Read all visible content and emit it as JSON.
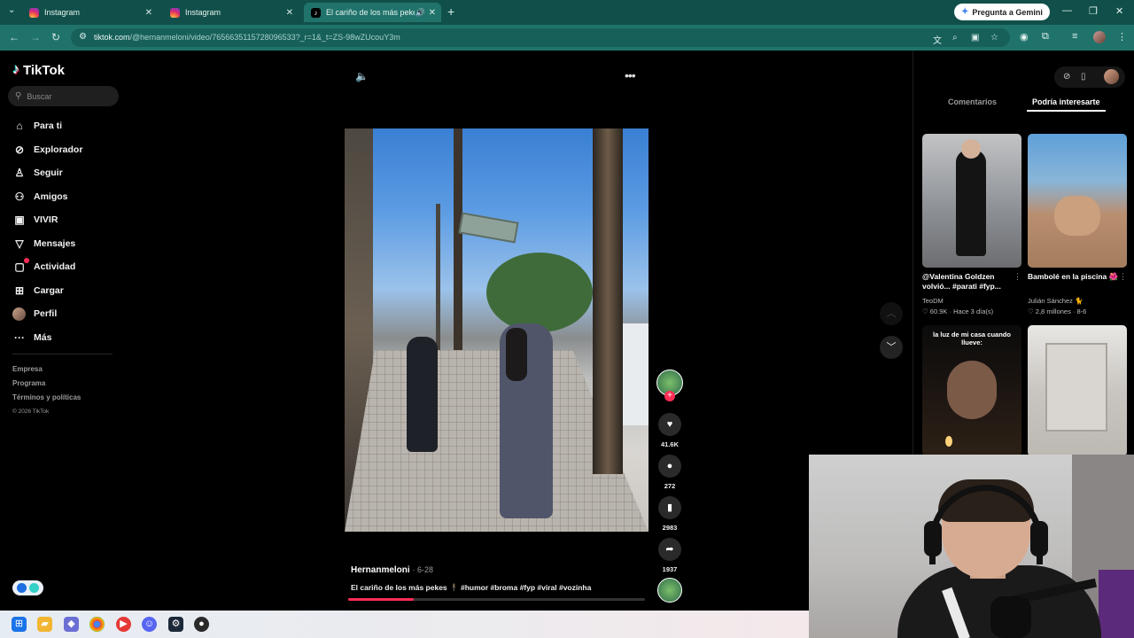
{
  "browser": {
    "tabs": [
      {
        "label": "Instagram",
        "icon": "instagram-icon"
      },
      {
        "label": "Instagram",
        "icon": "instagram-icon"
      },
      {
        "label": "El cariño de los más pekes",
        "icon": "tiktok-icon",
        "active": true
      }
    ],
    "gemini_label": "Pregunta a Gemini",
    "url_main": "tiktok.com",
    "url_rest": "/@hernanmeloni/video/7656635115728096533?_r=1&_t=ZS-98wZUcouY3m"
  },
  "sidebar": {
    "brand": "TikTok",
    "search_placeholder": "Buscar",
    "nav": [
      {
        "label": "Para ti",
        "icon": "home-icon"
      },
      {
        "label": "Explorador",
        "icon": "compass-icon"
      },
      {
        "label": "Seguir",
        "icon": "follow-icon"
      },
      {
        "label": "Amigos",
        "icon": "friends-icon"
      },
      {
        "label": "VIVIR",
        "icon": "live-icon"
      },
      {
        "label": "Mensajes",
        "icon": "messages-icon"
      },
      {
        "label": "Actividad",
        "icon": "activity-icon"
      },
      {
        "label": "Cargar",
        "icon": "upload-icon"
      },
      {
        "label": "Perfil",
        "icon": "profile-avatar"
      },
      {
        "label": "Más",
        "icon": "more-dots-icon"
      }
    ],
    "footer": [
      "Empresa",
      "Programa",
      "Términos y políticas"
    ],
    "copyright": "© 2026 TikTok"
  },
  "video": {
    "author": "Hernanmeloni",
    "date": "· 6-28",
    "caption": "El cariño de los más pekes 🕴 #humor #broma #fyp #viral #vozinha",
    "progress": 0.22,
    "stats": {
      "likes": "41.6K",
      "comments": "272",
      "saves": "2983",
      "shares": "1937"
    }
  },
  "right_panel": {
    "tabs": [
      {
        "label": "Comentarios",
        "active": false
      },
      {
        "label": "Podría interesarte",
        "active": true
      }
    ],
    "videos": [
      {
        "title": "@Valentina Goldzen volvió... #parati #fyp...",
        "author": "TeoDM",
        "likes": "♡ 60.9K",
        "time": "Hace 3 día(s)"
      },
      {
        "title": "Bambolé en la piscina 🌺",
        "author": "Julián Sánchez 🐈",
        "likes": "♡ 2,8 millones",
        "time": "8-6"
      },
      {
        "overlay_text": "la luz de mi casa cuando llueve:"
      },
      {}
    ]
  },
  "colors": {
    "accent": "#fe2c55",
    "browser_tabbar": "#11504a",
    "browser_toolbar": "#20736b"
  }
}
